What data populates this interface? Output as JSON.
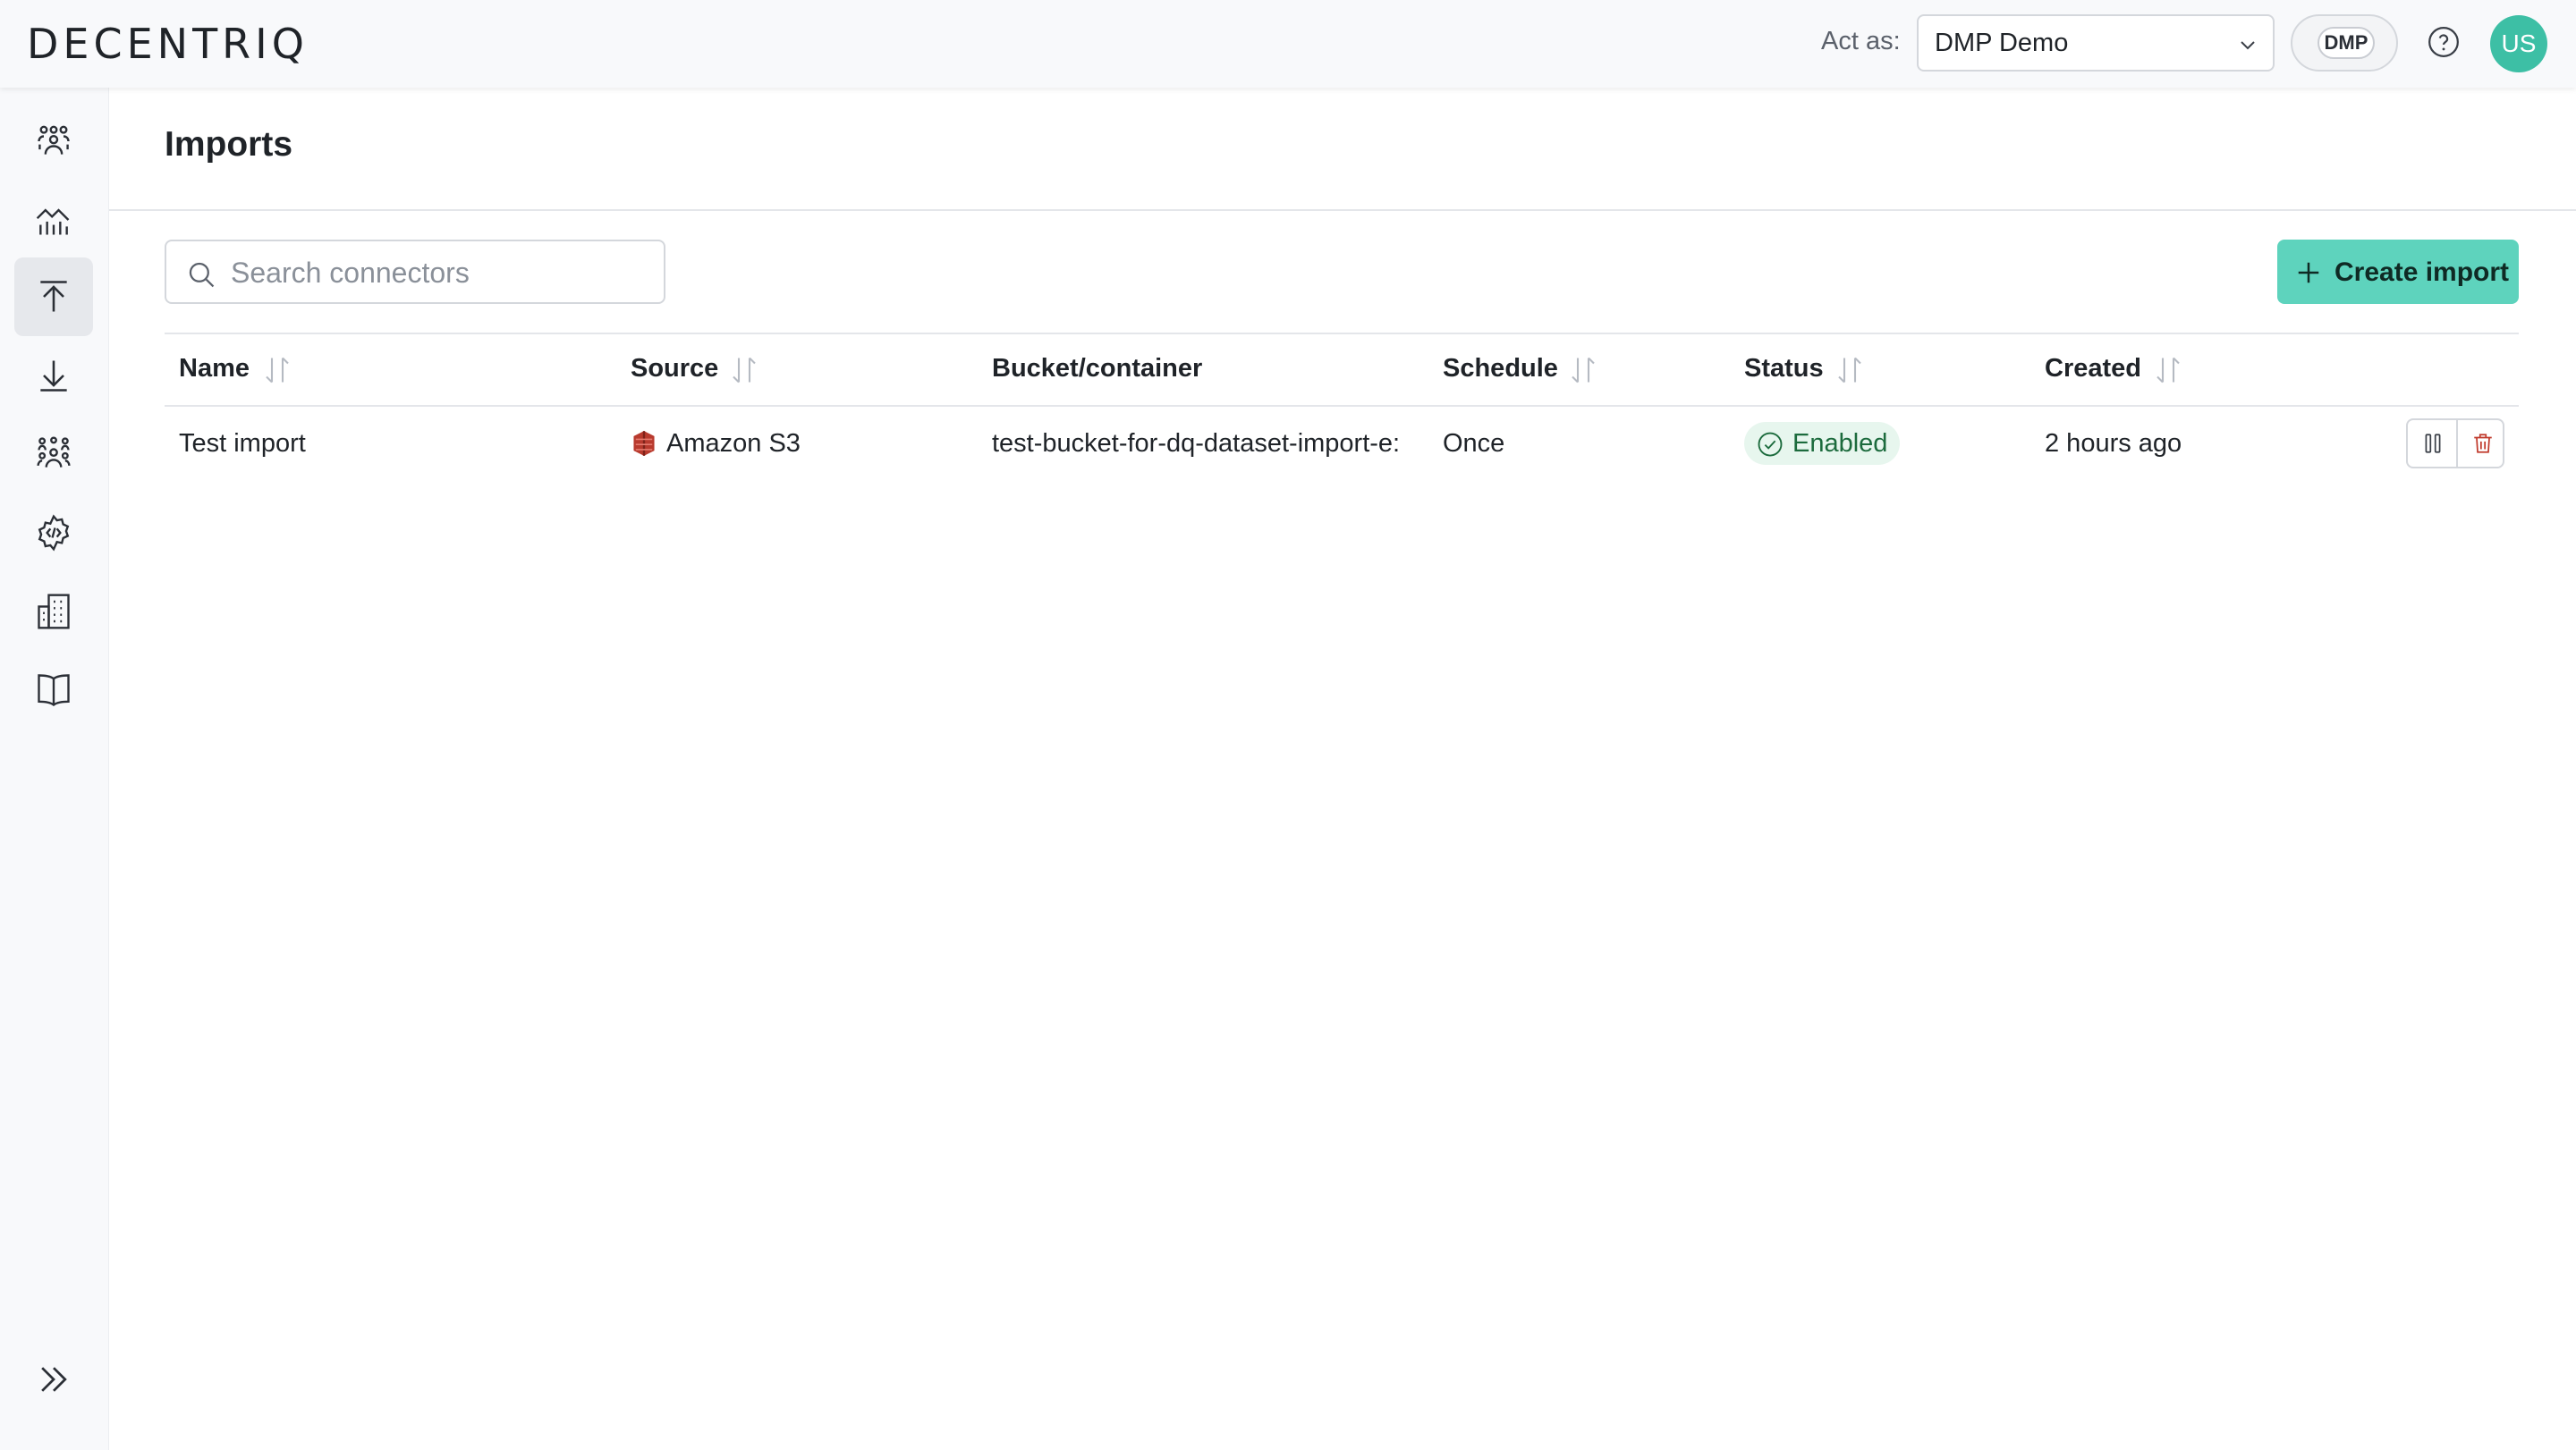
{
  "brand": {
    "logo_text": "DECENTRIQ"
  },
  "header": {
    "act_as_label": "Act as:",
    "org_selected": "DMP Demo",
    "org_badge": "DMP",
    "avatar_initials": "US"
  },
  "sidebar": {
    "items": [
      {
        "icon": "collaboration-icon"
      },
      {
        "icon": "insights-chart-icon"
      },
      {
        "icon": "imports-upload-icon",
        "active": true
      },
      {
        "icon": "exports-download-icon"
      },
      {
        "icon": "audiences-icon"
      },
      {
        "icon": "developer-settings-icon"
      },
      {
        "icon": "organization-building-icon"
      },
      {
        "icon": "documentation-book-icon"
      }
    ],
    "expand_icon": "double-chevron-right-icon"
  },
  "page": {
    "title": "Imports",
    "search_placeholder": "Search connectors",
    "create_button_label": "Create import"
  },
  "table": {
    "columns": [
      "Name",
      "Source",
      "Bucket/container",
      "Schedule",
      "Status",
      "Created"
    ],
    "rows": [
      {
        "name": "Test import",
        "source": "Amazon S3",
        "bucket": "test-bucket-for-dq-dataset-import-e:",
        "schedule": "Once",
        "status": "Enabled",
        "created": "2 hours ago"
      }
    ]
  },
  "colors": {
    "accent": "#5ed3bd",
    "avatar": "#3dbfa5",
    "status_enabled_bg": "#e7f6ee",
    "status_enabled_fg": "#1c6b3d",
    "delete_red": "#c0392b",
    "s3_red": "#b83a2e"
  }
}
